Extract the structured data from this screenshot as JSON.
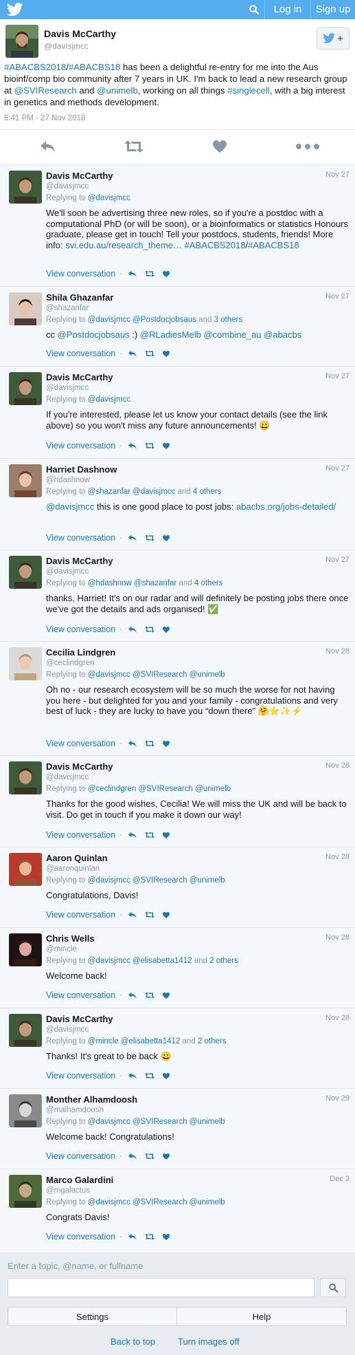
{
  "topbar": {
    "login": "Log in",
    "signup": "Sign up"
  },
  "main_tweet": {
    "name": "Davis McCarthy",
    "handle": "@davisjmcc",
    "parts": [
      {
        "t": "#ABACBS2018",
        "link": true
      },
      {
        "t": "/",
        "link": false
      },
      {
        "t": "#ABACBS18",
        "link": true
      },
      {
        "t": " has been a delightful re-entry for me into the Aus bioinf/comp bio community after 7 years in UK. I'm back to lead a new research group at ",
        "link": false
      },
      {
        "t": "@SVIResearch",
        "link": true
      },
      {
        "t": " and ",
        "link": false
      },
      {
        "t": "@unimelb",
        "link": true
      },
      {
        "t": ", working on all things ",
        "link": false
      },
      {
        "t": "#singlecell",
        "link": true
      },
      {
        "t": ", with a big interest in genetics and methods development.",
        "link": false
      }
    ],
    "time": "8:41 PM - 27 Nov 2018"
  },
  "view_conversation": "View conversation",
  "replying_prefix": "Replying to",
  "replies": [
    {
      "name": "Davis McCarthy",
      "handle": "@davisjmcc",
      "date": "Nov 27",
      "replying": [
        {
          "t": "@davisjmcc",
          "link": true
        }
      ],
      "body": [
        {
          "t": "We'll soon be advertising three new roles, so if you're a postdoc with a computational PhD (or will be soon), or a bioinformatics or statistics Honours graduate, please get in touch! Tell your postdocs, students, friends! More info: ",
          "link": false
        },
        {
          "t": "svi.edu.au/research_theme…",
          "link": true
        },
        {
          "t": " ",
          "link": false
        },
        {
          "t": "#ABACBS2018",
          "link": true
        },
        {
          "t": "/",
          "link": false
        },
        {
          "t": "#ABACBS18",
          "link": true
        }
      ]
    },
    {
      "name": "Shila Ghazanfar",
      "handle": "@shazanfar",
      "date": "Nov 27",
      "replying": [
        {
          "t": "@davisjmcc",
          "link": true
        },
        {
          "t": " ",
          "link": false
        },
        {
          "t": "@Postdocjobsaus",
          "link": true
        },
        {
          "t": " and ",
          "link": false
        },
        {
          "t": "3 others",
          "link": true
        }
      ],
      "body": [
        {
          "t": "cc ",
          "link": false
        },
        {
          "t": "@Postdocjobsaus",
          "link": true
        },
        {
          "t": " :) ",
          "link": false
        },
        {
          "t": "@RLadiesMelb",
          "link": true
        },
        {
          "t": " ",
          "link": false
        },
        {
          "t": "@combine_au",
          "link": true
        },
        {
          "t": " ",
          "link": false
        },
        {
          "t": "@abacbs",
          "link": true
        }
      ]
    },
    {
      "name": "Davis McCarthy",
      "handle": "@davisjmcc",
      "date": "Nov 27",
      "replying": [
        {
          "t": "@davisjmcc",
          "link": true
        }
      ],
      "body": [
        {
          "t": "If you're interested, please let us know your contact details (see the link above) so you won't miss any future announcements! 😀",
          "link": false
        }
      ]
    },
    {
      "name": "Harriet Dashnow",
      "handle": "@hdashnow",
      "date": "Nov 27",
      "replying": [
        {
          "t": "@shazanfar",
          "link": true
        },
        {
          "t": " ",
          "link": false
        },
        {
          "t": "@davisjmcc",
          "link": true
        },
        {
          "t": " and ",
          "link": false
        },
        {
          "t": "4 others",
          "link": true
        }
      ],
      "body": [
        {
          "t": "@davisjmcc",
          "link": true
        },
        {
          "t": " this is one good place to post jobs: ",
          "link": false
        },
        {
          "t": "abacbs.org/jobs-detailed/",
          "link": true
        }
      ]
    },
    {
      "name": "Davis McCarthy",
      "handle": "@davisjmcc",
      "date": "Nov 27",
      "replying": [
        {
          "t": "@hdashnow",
          "link": true
        },
        {
          "t": " ",
          "link": false
        },
        {
          "t": "@shazanfar",
          "link": true
        },
        {
          "t": " and ",
          "link": false
        },
        {
          "t": "4 others",
          "link": true
        }
      ],
      "body": [
        {
          "t": "thanks, Harriet! It's on our radar and will definitely be posting jobs there once we've got the details and ads organised! ✅",
          "link": false
        }
      ]
    },
    {
      "name": "Cecilia Lindgren",
      "handle": "@ceclindgren",
      "date": "Nov 28",
      "replying": [
        {
          "t": "@davisjmcc",
          "link": true
        },
        {
          "t": " ",
          "link": false
        },
        {
          "t": "@SVIResearch",
          "link": true
        },
        {
          "t": " ",
          "link": false
        },
        {
          "t": "@unimelb",
          "link": true
        }
      ],
      "body": [
        {
          "t": "Oh no - our research ecosystem will be so much the worse for not having you here - but delighted for you and your family - congratulations and very best of luck - they are lucky to have you “down there” 🤗⭐✨⚡",
          "link": false
        }
      ]
    },
    {
      "name": "Davis McCarthy",
      "handle": "@davisjmcc",
      "date": "Nov 28",
      "replying": [
        {
          "t": "@ceclindgren",
          "link": true
        },
        {
          "t": " ",
          "link": false
        },
        {
          "t": "@SVIResearch",
          "link": true
        },
        {
          "t": " ",
          "link": false
        },
        {
          "t": "@unimelb",
          "link": true
        }
      ],
      "body": [
        {
          "t": "Thanks for the good wishes, Cecilia! We will miss the UK and will be back to visit. Do get in touch if you make it down our way!",
          "link": false
        }
      ]
    },
    {
      "name": "Aaron Quinlan",
      "handle": "@aaronquinlan",
      "date": "Nov 28",
      "replying": [
        {
          "t": "@davisjmcc",
          "link": true
        },
        {
          "t": " ",
          "link": false
        },
        {
          "t": "@SVIResearch",
          "link": true
        },
        {
          "t": " ",
          "link": false
        },
        {
          "t": "@unimelb",
          "link": true
        }
      ],
      "body": [
        {
          "t": "Congratulations, Davis!",
          "link": false
        }
      ]
    },
    {
      "name": "Chris Wells",
      "handle": "@mincle",
      "date": "Nov 28",
      "replying": [
        {
          "t": "@davisjmcc",
          "link": true
        },
        {
          "t": " ",
          "link": false
        },
        {
          "t": "@elisabetta1412",
          "link": true
        },
        {
          "t": " and ",
          "link": false
        },
        {
          "t": "2 others",
          "link": true
        }
      ],
      "body": [
        {
          "t": "Welcome back!",
          "link": false
        }
      ]
    },
    {
      "name": "Davis McCarthy",
      "handle": "@davisjmcc",
      "date": "Nov 28",
      "replying": [
        {
          "t": "@mincle",
          "link": true
        },
        {
          "t": " ",
          "link": false
        },
        {
          "t": "@elisabetta1412",
          "link": true
        },
        {
          "t": " and ",
          "link": false
        },
        {
          "t": "2 others",
          "link": true
        }
      ],
      "body": [
        {
          "t": "Thanks! It's great to be back 😀",
          "link": false
        }
      ]
    },
    {
      "name": "Monther Alhamdoosh",
      "handle": "@malhamdoosh",
      "date": "Nov 29",
      "replying": [
        {
          "t": "@davisjmcc",
          "link": true
        },
        {
          "t": " ",
          "link": false
        },
        {
          "t": "@SVIResearch",
          "link": true
        },
        {
          "t": " ",
          "link": false
        },
        {
          "t": "@unimelb",
          "link": true
        }
      ],
      "body": [
        {
          "t": "Welcome back! Congratulations!",
          "link": false
        }
      ]
    },
    {
      "name": "Marco Galardini",
      "handle": "@mgalactus",
      "date": "Dec 3",
      "replying": [
        {
          "t": "@davisjmcc",
          "link": true
        },
        {
          "t": " ",
          "link": false
        },
        {
          "t": "@SVIResearch",
          "link": true
        },
        {
          "t": " ",
          "link": false
        },
        {
          "t": "@unimelb",
          "link": true
        }
      ],
      "body": [
        {
          "t": "Congrats Davis!",
          "link": false
        }
      ]
    }
  ],
  "bottom": {
    "search_hint": "Enter a topic, @name, or fullname",
    "settings": "Settings",
    "help": "Help",
    "back_to_top": "Back to top",
    "images_off": "Turn images off"
  }
}
